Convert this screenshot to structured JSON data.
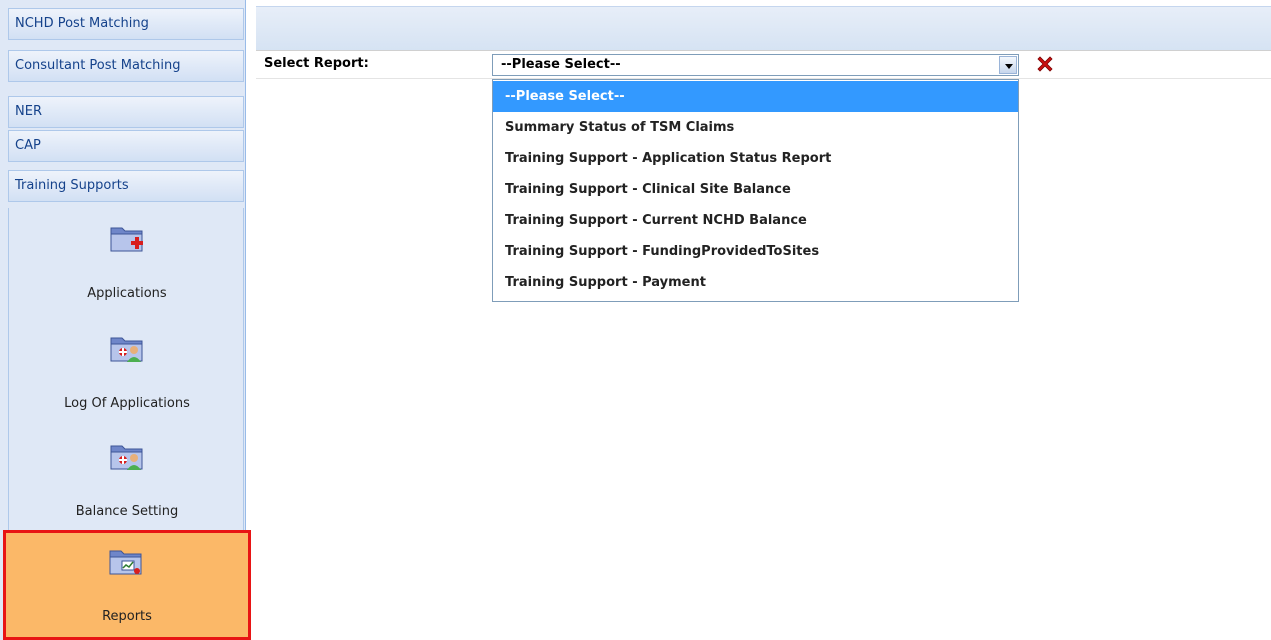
{
  "sidebar": {
    "sections": [
      {
        "label": "NCHD Post Matching"
      },
      {
        "label": "Consultant Post Matching"
      },
      {
        "label": "NER"
      },
      {
        "label": "CAP"
      },
      {
        "label": "Training Supports"
      }
    ],
    "items": [
      {
        "label": "Applications",
        "icon": "folder-add-icon"
      },
      {
        "label": "Log Of Applications",
        "icon": "folder-user-icon"
      },
      {
        "label": "Balance Setting",
        "icon": "folder-user-icon"
      },
      {
        "label": "Reports",
        "icon": "folder-report-icon",
        "selected": true
      }
    ]
  },
  "report_selector": {
    "label": "Select Report:",
    "value": "--Please Select--",
    "options": [
      {
        "label": "--Please Select--",
        "selected": true
      },
      {
        "label": "Summary Status of TSM Claims"
      },
      {
        "label": "Training Support - Application Status Report"
      },
      {
        "label": "Training Support - Clinical Site Balance"
      },
      {
        "label": "Training Support - Current NCHD Balance"
      },
      {
        "label": "Training Support - FundingProvidedToSites"
      },
      {
        "label": "Training Support - Payment"
      }
    ]
  },
  "colors": {
    "highlight": "#3399ff",
    "selected_tile": "#fbb868",
    "selected_border": "#e81414",
    "clear_icon": "#cc1111"
  }
}
